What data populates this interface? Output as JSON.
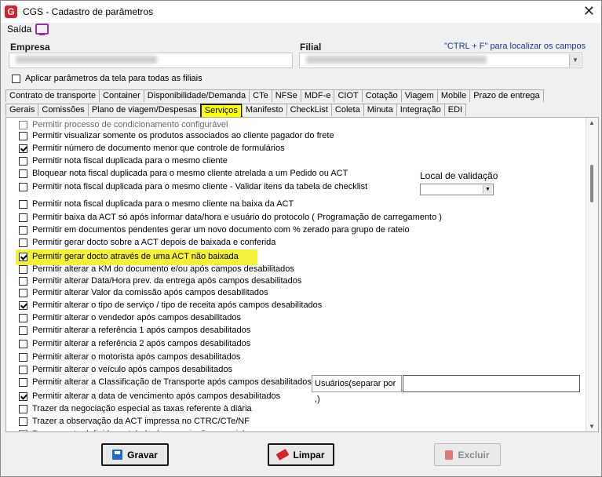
{
  "window": {
    "title": "CGS - Cadastro de parâmetros",
    "logo_text": "G"
  },
  "menu": {
    "saida": "Saída"
  },
  "header": {
    "empresa_label": "Empresa",
    "filial_label": "Filial",
    "hint": "\"CTRL + F\" para localizar os campos",
    "apply_all_label": "Aplicar parâmetros da tela para todas as filiais"
  },
  "tabs_row1": [
    "Contrato de transporte",
    "Container",
    "Disponibilidade/Demanda",
    "CTe",
    "NFSe",
    "MDF-e",
    "CIOT",
    "Cotação",
    "Viagem",
    "Mobile",
    "Prazo de entrega"
  ],
  "tabs_row2": [
    "Gerais",
    "Comissões",
    "Plano de viagem/Despesas",
    "Serviços",
    "Manifesto",
    "CheckList",
    "Coleta",
    "Minuta",
    "Integração",
    "EDI"
  ],
  "active_tab": "Serviços",
  "items": [
    {
      "label": "Permitir processo de condicionamento configurável",
      "checked": false
    },
    {
      "label": "Permitir visualizar somente os produtos associados ao cliente pagador do frete",
      "checked": false
    },
    {
      "label": "Permitir número de documento menor que controle de formulários",
      "checked": true
    },
    {
      "label": "Permitir nota fiscal duplicada para o mesmo cliente",
      "checked": false
    },
    {
      "label": "Bloquear nota fiscal duplicada para o mesmo cliente atrelada a um Pedido ou ACT",
      "checked": false
    },
    {
      "label": "Permitir nota fiscal duplicada para o mesmo cliente - Validar itens da tabela de checklist",
      "checked": false
    },
    {
      "label": "Permitir nota fiscal duplicada para o mesmo cliente na baixa da ACT",
      "checked": false
    },
    {
      "label": "Permitir baixa da ACT só após informar data/hora e usuário do protocolo ( Programação de carregamento )",
      "checked": false
    },
    {
      "label": "Permitir em documentos pendentes gerar um novo documento com % zerado para grupo de rateio",
      "checked": false
    },
    {
      "label": "Permitir gerar docto sobre a ACT depois de baixada e conferida",
      "checked": false
    },
    {
      "label": "Permitir gerar docto através de uma ACT não baixada",
      "checked": true
    },
    {
      "label": "Permitir alterar a KM do documento e/ou após campos desabilitados",
      "checked": false
    },
    {
      "label": "Permitir alterar Data/Hora prev. da entrega após campos desabilitados",
      "checked": false
    },
    {
      "label": "Permitir alterar Valor da comissão após campos desabilitados",
      "checked": false
    },
    {
      "label": "Permitir alterar o tipo de serviço / tipo de receita após campos desabilitados",
      "checked": true
    },
    {
      "label": "Permitir alterar o vendedor após campos desabilitados",
      "checked": false
    },
    {
      "label": "Permitir alterar a referência 1 após campos desabilitados",
      "checked": false
    },
    {
      "label": "Permitir alterar a referência 2 após campos desabilitados",
      "checked": false
    },
    {
      "label": "Permitir alterar o motorista após campos desabilitados",
      "checked": false
    },
    {
      "label": "Permitir alterar o veículo após campos desabilitados",
      "checked": false
    },
    {
      "label": "Permitir alterar a Classificação de Transporte após campos desabilitados ->",
      "checked": false
    },
    {
      "label": "Permitir alterar a data de vencimento após campos desabilitados",
      "checked": true
    },
    {
      "label": "Trazer da negociação especial as taxas referente à diária",
      "checked": false
    },
    {
      "label": "Trazer a observação da ACT impressa no CTRC/CTe/NF",
      "checked": false
    },
    {
      "label": "Trazer a rota definida na tabela de negociação especial",
      "checked": false
    }
  ],
  "local_validacao_label": "Local de validação",
  "usuarios_label": "Usuários(separar por ,)",
  "buttons": {
    "gravar": "Gravar",
    "limpar": "Limpar",
    "excluir": "Excluir"
  },
  "colors": {
    "highlight": "#f5f03a",
    "active_tab": "#ffff00",
    "accent_icon": "#9b2db5"
  }
}
